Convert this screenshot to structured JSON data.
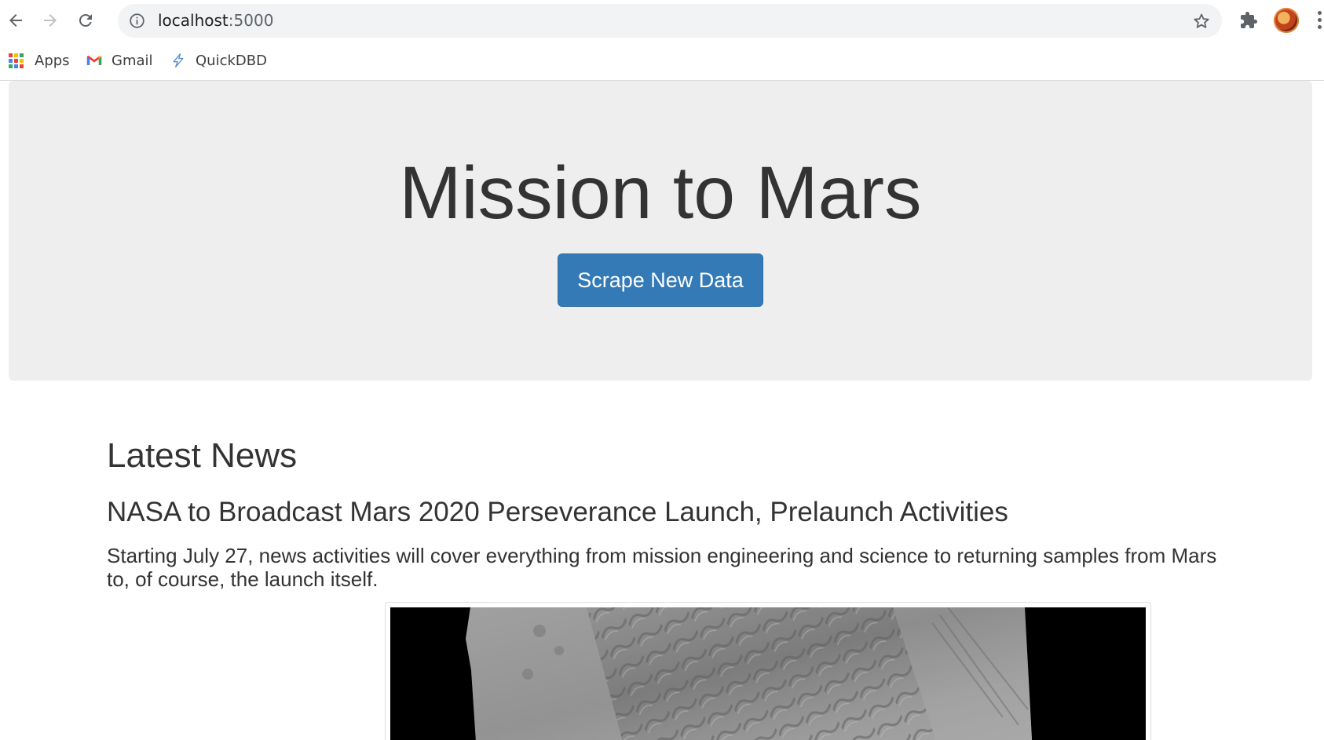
{
  "browser": {
    "url_host": "localhost",
    "url_port": ":5000",
    "bookmarks": [
      {
        "label": "Apps",
        "icon": "apps-grid-icon"
      },
      {
        "label": "Gmail",
        "icon": "gmail-icon"
      },
      {
        "label": "QuickDBD",
        "icon": "quickdbd-icon"
      }
    ]
  },
  "jumbotron": {
    "title": "Mission to Mars",
    "button_label": "Scrape New Data",
    "button_color": "#337ab7"
  },
  "news": {
    "section_title": "Latest News",
    "headline": "NASA to Broadcast Mars 2020 Perseverance Launch, Prelaunch Activities",
    "teaser": "Starting July 27, news activities will cover everything from mission engineering and science to returning samples from Mars to, of course, the launch itself."
  }
}
